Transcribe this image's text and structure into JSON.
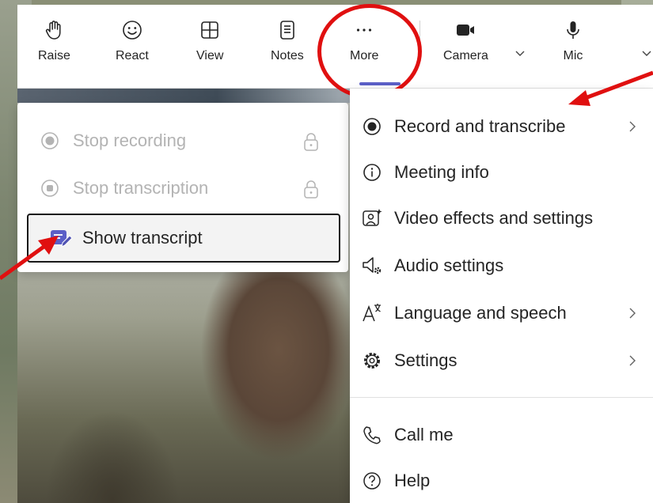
{
  "toolbar": {
    "raise": "Raise",
    "react": "React",
    "view": "View",
    "notes": "Notes",
    "more": "More",
    "camera": "Camera",
    "mic": "Mic"
  },
  "submenu": {
    "stop_recording": "Stop recording",
    "stop_transcription": "Stop transcription",
    "show_transcript": "Show transcript"
  },
  "menu": {
    "record": "Record and transcribe",
    "meeting_info": "Meeting info",
    "video_effects": "Video effects and settings",
    "audio_settings": "Audio settings",
    "language": "Language and speech",
    "settings": "Settings",
    "call_me": "Call me",
    "help": "Help"
  },
  "colors": {
    "accent": "#5b5fc7",
    "annotation": "#e01010",
    "disabled_text": "#b3b3b3",
    "text": "#242424"
  }
}
